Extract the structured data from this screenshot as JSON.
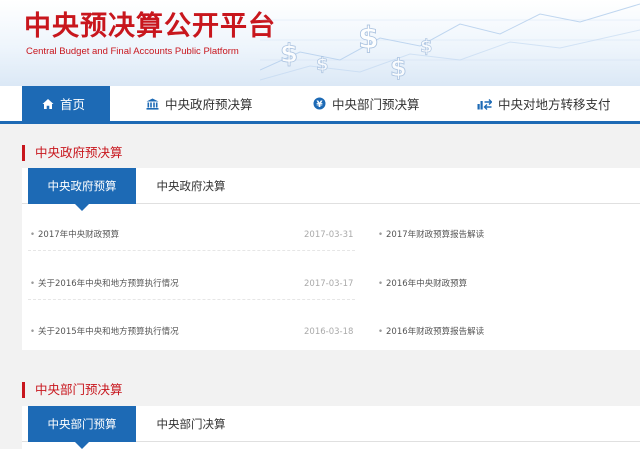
{
  "header": {
    "logo_cn": "中央预决算公开平台",
    "logo_en": "Central Budget and Final Accounts Public Platform"
  },
  "nav": [
    {
      "label": "首页",
      "icon": "home-icon",
      "active": true
    },
    {
      "label": "中央政府预决算",
      "icon": "government-building-icon"
    },
    {
      "label": "中央部门预决算",
      "icon": "yuan-coin-icon"
    },
    {
      "label": "中央对地方转移支付",
      "icon": "transfer-payment-icon"
    }
  ],
  "sections": [
    {
      "title": "中央政府预决算",
      "tabs": [
        "中央政府预算",
        "中央政府决算"
      ],
      "left_items": [
        {
          "title": "2017年中央财政预算",
          "date": "2017-03-31"
        },
        {
          "title": "关于2016年中央和地方预算执行情况",
          "date": "2017-03-17"
        },
        {
          "title": "关于2015年中央和地方预算执行情况",
          "date": "2016-03-18"
        }
      ],
      "right_items": [
        {
          "title": "2017年财政预算报告解读"
        },
        {
          "title": "2016年中央财政预算"
        },
        {
          "title": "2016年财政预算报告解读"
        }
      ]
    },
    {
      "title": "中央部门预决算",
      "tabs": [
        "中央部门预算",
        "中央部门决算"
      ]
    }
  ],
  "colors": {
    "brand_red": "#c8161d",
    "nav_blue": "#1d6ab5"
  }
}
